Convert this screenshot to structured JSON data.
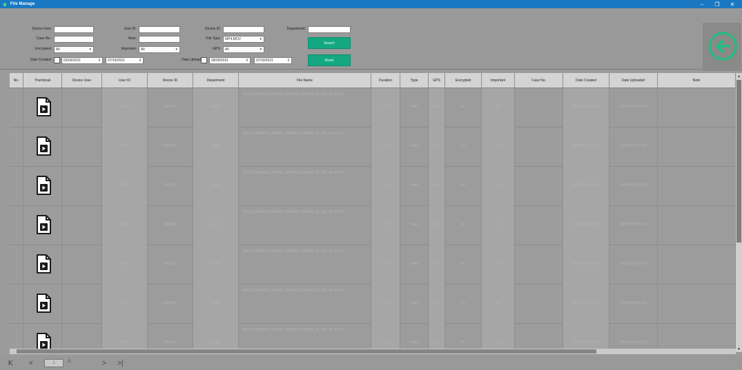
{
  "window": {
    "title": "File Manage",
    "minimize_glyph": "–",
    "maximize_glyph": "❐",
    "close_glyph": "✕"
  },
  "search": {
    "device_user_label": "Device User:",
    "case_no_label": "Case No.:",
    "encrypted_label": "Encrypted:",
    "encrypted_value": "All",
    "date_created_label": "Date Created:",
    "date_created_from": "02/09/2021",
    "date_created_to": "07/19/2021",
    "user_id_label": "User ID:",
    "note_label": "Note:",
    "important_label": "Important:",
    "important_value": "All",
    "date_uploaded_label": "Date Uploaded:",
    "date_uploaded_from": "28/09/2021",
    "date_uploaded_to": "07/19/2021",
    "device_id_label": "Device ID:",
    "file_type_label": "File Type:",
    "file_type_value": "MP4,MOV",
    "gps_label": "GPS:",
    "gps_value": "All",
    "department_label": "Department:",
    "search_button": "Search",
    "reset_button": "Reset"
  },
  "grid": {
    "columns": [
      "No.",
      "Thumbnail",
      "Device User",
      "User ID",
      "Device ID",
      "Department",
      "File Name",
      "Duration",
      "Type",
      "GPS",
      "Encrypted",
      "Important",
      "Case No.",
      "Date Created",
      "Date Uploaded",
      "Note"
    ],
    "rows": [
      {
        "user_id": "00000",
        "device_id": "0000000",
        "department": "admin",
        "file_name": "REC0_00000000_000000_00000000_000000_00_000_00.00001",
        "duration": "0:00",
        "type": "Video",
        "gps": "Yes",
        "encrypted": "No",
        "important": "0.0",
        "date_created": "00/00/0000 00:00",
        "date_uploaded": "00/00/0000 00:00"
      },
      {
        "user_id": "00000",
        "device_id": "0000000",
        "department": "admin",
        "file_name": "REC0_00000000_000000_00000000_000000_00_000_00.00001",
        "duration": "0:00",
        "type": "Video",
        "gps": "Yes",
        "encrypted": "No",
        "important": "0.0",
        "date_created": "00/00/0000 00:00",
        "date_uploaded": "00/00/0000 00:00"
      },
      {
        "user_id": "00000",
        "device_id": "0000000",
        "department": "admin",
        "file_name": "REC0_00000000_000000_00000000_000000_00_000_00.00001",
        "duration": "0:00",
        "type": "Video",
        "gps": "Yes",
        "encrypted": "No",
        "important": "0.0",
        "date_created": "00/00/0000 00:00",
        "date_uploaded": "00/00/0000 00:00"
      },
      {
        "user_id": "00000",
        "device_id": "0000000",
        "department": "admin",
        "file_name": "REC0_00000000_000000_00000000_000000_00_000_00.00001",
        "duration": "0:00",
        "type": "Video",
        "gps": "Yes",
        "encrypted": "No",
        "important": "0.0",
        "date_created": "00/00/0000 00:00",
        "date_uploaded": "00/00/0000 00:00"
      },
      {
        "user_id": "00000",
        "device_id": "0000000",
        "department": "admin",
        "file_name": "REC0_00000000_000000_00000000_000000_00_000_00.00001",
        "duration": "0:00",
        "type": "Video",
        "gps": "Yes",
        "encrypted": "No",
        "important": "0.0",
        "date_created": "00/00/0000 00:00",
        "date_uploaded": "00/00/0000 00:00"
      },
      {
        "user_id": "00000",
        "device_id": "0000000",
        "department": "admin",
        "file_name": "REC0_00000000_000000_00000000_000000_00_000_00.00001",
        "duration": "0:00",
        "type": "Video",
        "gps": "Yes",
        "encrypted": "No",
        "important": "0.0",
        "date_created": "00/00/0000 00:00",
        "date_uploaded": "00/00/0000 00:00"
      },
      {
        "user_id": "00000",
        "device_id": "0000000",
        "department": "admin",
        "file_name": "REC0_00000000_000000_00000000_000000_00_000_00.00001",
        "duration": "0:00",
        "type": "Video",
        "gps": "Yes",
        "encrypted": "No",
        "important": "0.0",
        "date_created": "00/00/0000 00:00",
        "date_uploaded": "00/00/0000 00:00"
      }
    ]
  },
  "pager": {
    "first_label": "K",
    "prev_label": "<",
    "page_value": "1",
    "page_separator": "/1",
    "next_label": ">",
    "last_label": ">|"
  },
  "icons": {
    "thumbnail": "video-file-icon",
    "back": "back-arrow-circle-icon",
    "app": "app-logo-icon"
  },
  "colors": {
    "title_bar": "#1a78c2",
    "accent_button": "#13a882",
    "back_arrow": "#1dbf80"
  }
}
